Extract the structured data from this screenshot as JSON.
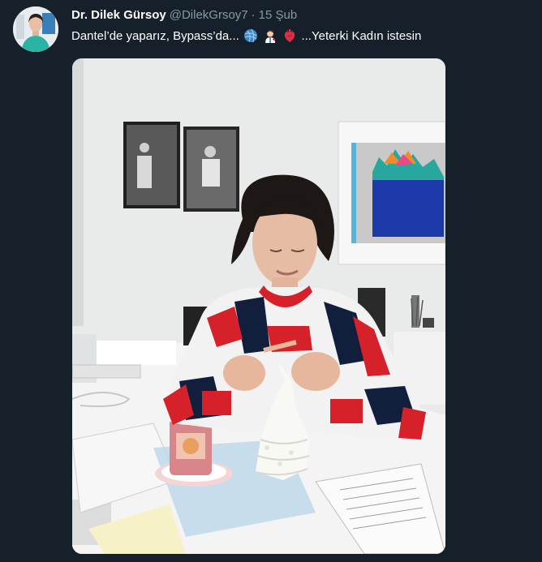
{
  "tweet": {
    "author_name": "Dr. Dilek Gürsoy",
    "author_handle": "@DilekGrsoy7",
    "separator": "·",
    "date": "15 Şub",
    "text_part1": "Dantel’de yaparız, Bypass’da...",
    "text_part2": "...Yeterki Kadın istesin",
    "emojis": [
      "yarn-ball-icon",
      "woman-health-worker-icon",
      "anatomical-heart-icon"
    ]
  },
  "media": {
    "description_icon": "photo"
  },
  "colors": {
    "background": "#15202b",
    "secondary_text": "#8899a6",
    "primary_text": "#ffffff"
  }
}
